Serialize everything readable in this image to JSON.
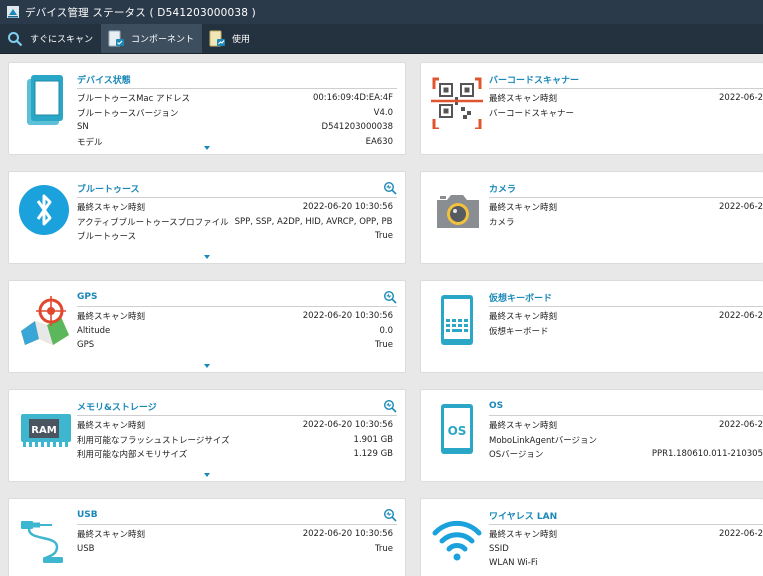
{
  "window": {
    "title": "デバイス管理 ステータス ( D541203000038 )"
  },
  "toolbar": {
    "scan_now": "すぐにスキャン",
    "components": "コンポーネント",
    "usage": "使用"
  },
  "colors": {
    "accent": "#1b88b8",
    "titlebar": "#2a3a4a",
    "toolbar": "#24323f",
    "toolbar_active": "#3d4e5f"
  },
  "left": {
    "device": {
      "title": "デバイス状態",
      "icon": "phone-icon",
      "rows": [
        {
          "k": "ブルートゥースMac アドレス",
          "v": "00:16:09:4D:EA:4F"
        },
        {
          "k": "ブルートゥースバージョン",
          "v": "V4.0"
        },
        {
          "k": "SN",
          "v": "D541203000038"
        },
        {
          "k": "モデル",
          "v": "EA630"
        }
      ]
    },
    "bluetooth": {
      "title": "ブルートゥース",
      "icon": "bluetooth-icon",
      "rows": [
        {
          "k": "最終スキャン時刻",
          "v": "2022-06-20 10:30:56"
        },
        {
          "k": "アクティブブルートゥースプロファイル",
          "v": "SPP, SSP, A2DP, HID, AVRCP, OPP, PB..."
        },
        {
          "k": "ブルートゥース",
          "v": "True"
        }
      ]
    },
    "gps": {
      "title": "GPS",
      "icon": "map-pin-icon",
      "rows": [
        {
          "k": "最終スキャン時刻",
          "v": "2022-06-20 10:30:56"
        },
        {
          "k": "Altitude",
          "v": "0.0"
        },
        {
          "k": "GPS",
          "v": "True"
        }
      ]
    },
    "memory": {
      "title": "メモリ&ストレージ",
      "icon": "ram-icon",
      "icon_text": "RAM",
      "rows": [
        {
          "k": "最終スキャン時刻",
          "v": "2022-06-20 10:30:56"
        },
        {
          "k": "利用可能なフラッシュストレージサイズ",
          "v": "1.901 GB"
        },
        {
          "k": "利用可能な内部メモリサイズ",
          "v": "1.129 GB"
        }
      ]
    },
    "usb": {
      "title": "USB",
      "icon": "usb-icon",
      "rows": [
        {
          "k": "最終スキャン時刻",
          "v": "2022-06-20 10:30:56"
        },
        {
          "k": "USB",
          "v": "True"
        }
      ]
    }
  },
  "right": {
    "barcode": {
      "title": "バーコードスキャナー",
      "icon": "barcode-scanner-icon",
      "rows": [
        {
          "k": "最終スキャン時刻",
          "v": "2022-06-2"
        },
        {
          "k": "バーコードスキャナー",
          "v": ""
        }
      ]
    },
    "camera": {
      "title": "カメラ",
      "icon": "camera-icon",
      "rows": [
        {
          "k": "最終スキャン時刻",
          "v": "2022-06-2"
        },
        {
          "k": "カメラ",
          "v": ""
        }
      ]
    },
    "keyboard": {
      "title": "仮想キーボード",
      "icon": "keyboard-icon",
      "rows": [
        {
          "k": "最終スキャン時刻",
          "v": "2022-06-2"
        },
        {
          "k": "仮想キーボード",
          "v": ""
        }
      ]
    },
    "os": {
      "title": "OS",
      "icon": "os-icon",
      "icon_text": "OS",
      "rows": [
        {
          "k": "最終スキャン時刻",
          "v": "2022-06-2"
        },
        {
          "k": "MoboLinkAgentバージョン",
          "v": ""
        },
        {
          "k": "OSバージョン",
          "v": "PPR1.180610.011-210305"
        }
      ]
    },
    "wlan": {
      "title": "ワイヤレス LAN",
      "icon": "wifi-icon",
      "rows": [
        {
          "k": "最終スキャン時刻",
          "v": "2022-06-2"
        },
        {
          "k": "SSID",
          "v": ""
        },
        {
          "k": "WLAN Wi-Fi",
          "v": ""
        }
      ]
    }
  }
}
